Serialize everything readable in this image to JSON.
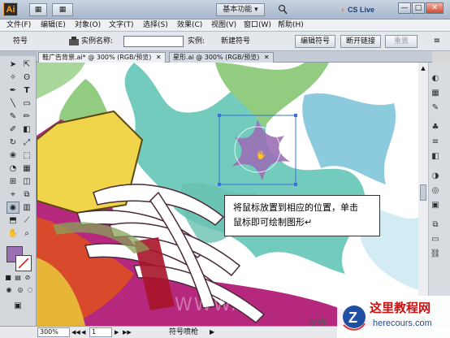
{
  "app": {
    "logo_text": "Ai",
    "workspace": "基本功能",
    "cs_live": "CS Live"
  },
  "titlebar_buttons": {
    "view": "▦",
    "arrange": "▦"
  },
  "window": {
    "minimize": "—",
    "maximize": "□",
    "close": "✕"
  },
  "menu": [
    "文件(F)",
    "编辑(E)",
    "对象(O)",
    "文字(T)",
    "选择(S)",
    "效果(C)",
    "视图(V)",
    "窗口(W)",
    "帮助(H)"
  ],
  "control": {
    "symbol_label": "符号",
    "instance_name_label": "实例名称:",
    "instance_name_value": "",
    "instance_label": "实例:",
    "new_symbol": "新建符号",
    "edit_symbol": "编辑符号",
    "break_link": "断开链接",
    "reset": "重置"
  },
  "tabs": [
    {
      "label": "鞋广告背景.ai* @ 300% (RGB/预览)",
      "close": "✕"
    },
    {
      "label": "星形.ai @ 300% (RGB/预览)",
      "close": "✕"
    }
  ],
  "tooltip": {
    "line1": "将鼠标放置到相应的位置，单击",
    "line2": "鼠标即可绘制图形↵"
  },
  "status": {
    "zoom": "300%",
    "page": "1",
    "tool": "符号喷枪"
  },
  "watermark": {
    "title": "这里教程网",
    "url": "herecours.com",
    "partial_text": "思缘"
  },
  "colors": {
    "fill_swatch": "#9b6fb6",
    "star": "#9b6fb6",
    "shoe_magenta": "#b5287e",
    "shoe_yellow": "#f0d54a",
    "shoe_lace": "#ffffff",
    "splash_teal": "#4bbcae",
    "splash_green": "#7cc36a"
  },
  "icons": {
    "toolbar": [
      "selection-tool",
      "direct-selection-tool",
      "magic-wand-tool",
      "lasso-tool",
      "pen-tool",
      "type-tool",
      "line-tool",
      "rectangle-tool",
      "paintbrush-tool",
      "pencil-tool",
      "blob-brush-tool",
      "eraser-tool",
      "rotate-tool",
      "scale-tool",
      "warp-tool",
      "free-transform-tool",
      "symbol-sprayer-tool",
      "column-graph-tool",
      "mesh-tool",
      "gradient-tool",
      "eyedropper-tool",
      "blend-tool",
      "live-paint-tool",
      "slice-tool",
      "hand-tool",
      "zoom-tool"
    ],
    "right_panel": [
      "color-panel-icon",
      "swatches-panel-icon",
      "brushes-panel-icon",
      "symbols-panel-icon",
      "stroke-panel-icon",
      "gradient-panel-icon",
      "transparency-panel-icon",
      "appearance-panel-icon",
      "graphic-styles-panel-icon",
      "layers-panel-icon",
      "artboards-panel-icon",
      "links-panel-icon"
    ]
  }
}
